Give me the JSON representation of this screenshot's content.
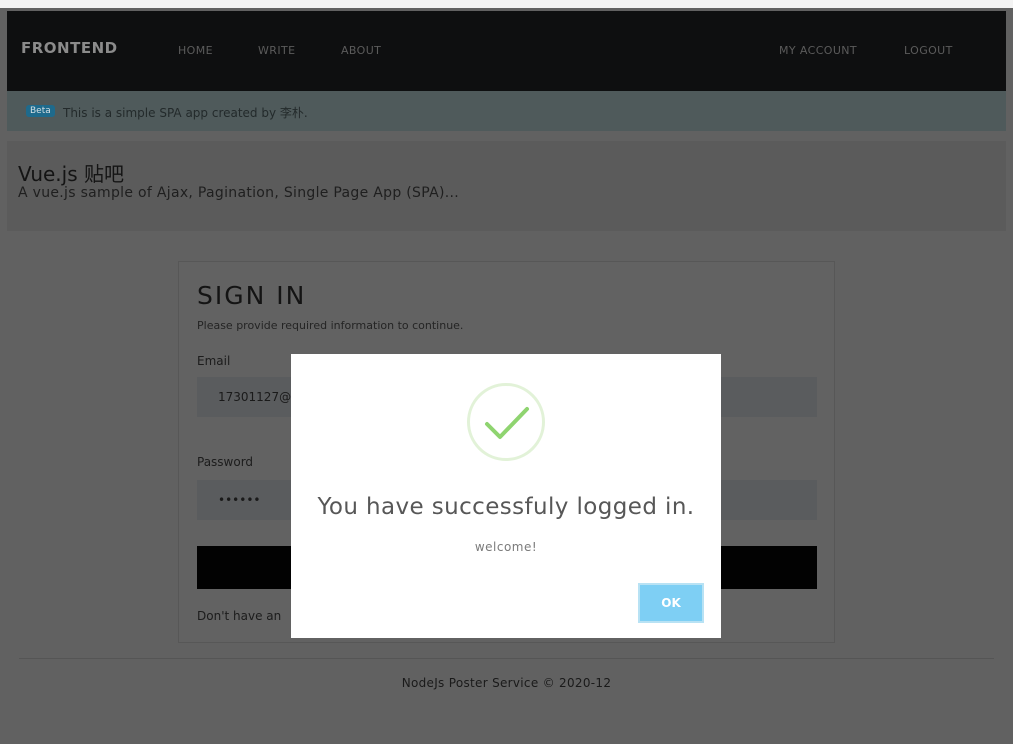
{
  "navbar": {
    "brand": "FRONTEND",
    "links": [
      "HOME",
      "WRITE",
      "ABOUT"
    ],
    "right_links": [
      "MY ACCOUNT",
      "LOGOUT"
    ]
  },
  "alert": {
    "badge": "Beta",
    "text": "This is a simple SPA app created by 李朴."
  },
  "jumbotron": {
    "title": "Vue.js 贴吧",
    "subtitle": "A vue.js sample of Ajax, Pagination, Single Page App (SPA)..."
  },
  "signin": {
    "title": "SIGN IN",
    "subtitle": "Please provide required information to continue.",
    "email_label": "Email",
    "email_value": "17301127@",
    "password_label": "Password",
    "password_value": "••••••",
    "footer_text": "Don't have an"
  },
  "footer": {
    "text": "NodeJs Poster Service © 2020-12"
  },
  "modal": {
    "icon": "success-checkmark-icon",
    "title": "You have successfuly logged in.",
    "text": "welcome!",
    "ok_label": "OK"
  },
  "colors": {
    "accent": "#7ecff4",
    "success": "#8fd470",
    "navbar": "#0e0f10"
  }
}
